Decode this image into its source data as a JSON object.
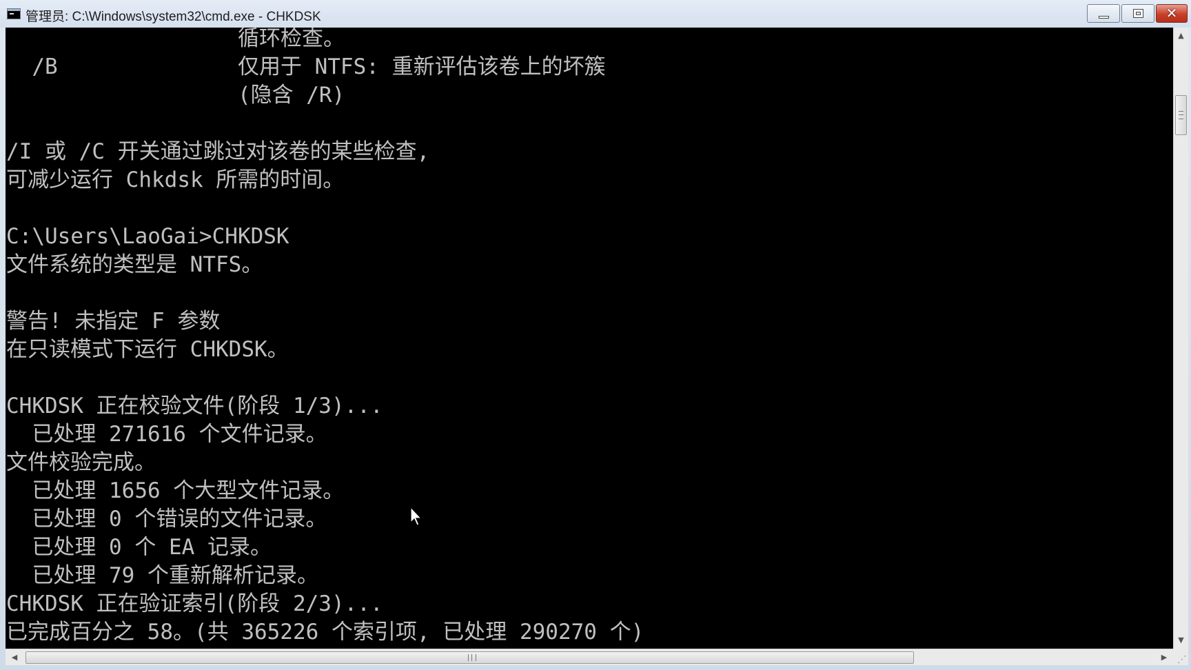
{
  "window": {
    "title": "管理员: C:\\Windows\\system32\\cmd.exe - CHKDSK",
    "controls": {
      "minimize": "minimize",
      "maximize": "maximize",
      "close": "✕"
    }
  },
  "console": {
    "lines": [
      "                  循环检查。",
      "  /B              仅用于 NTFS: 重新评估该卷上的坏簇",
      "                  (隐含 /R)",
      "",
      "/I 或 /C 开关通过跳过对该卷的某些检查,",
      "可减少运行 Chkdsk 所需的时间。",
      "",
      "C:\\Users\\LaoGai>CHKDSK",
      "文件系统的类型是 NTFS。",
      "",
      "警告! 未指定 F 参数",
      "在只读模式下运行 CHKDSK。",
      "",
      "CHKDSK 正在校验文件(阶段 1/3)...",
      "  已处理 271616 个文件记录。",
      "文件校验完成。",
      "  已处理 1656 个大型文件记录。",
      "  已处理 0 个错误的文件记录。",
      "  已处理 0 个 EA 记录。",
      "  已处理 79 个重新解析记录。",
      "CHKDSK 正在验证索引(阶段 2/3)...",
      "已完成百分之 58。(共 365226 个索引项, 已处理 290270 个)"
    ]
  },
  "scrollbars": {
    "up_arrow": "▲",
    "down_arrow": "▼",
    "left_arrow": "◀",
    "right_arrow": "▶"
  },
  "colors": {
    "console_bg": "#000000",
    "console_text": "#c0c0c0",
    "close_button": "#c6402a"
  }
}
